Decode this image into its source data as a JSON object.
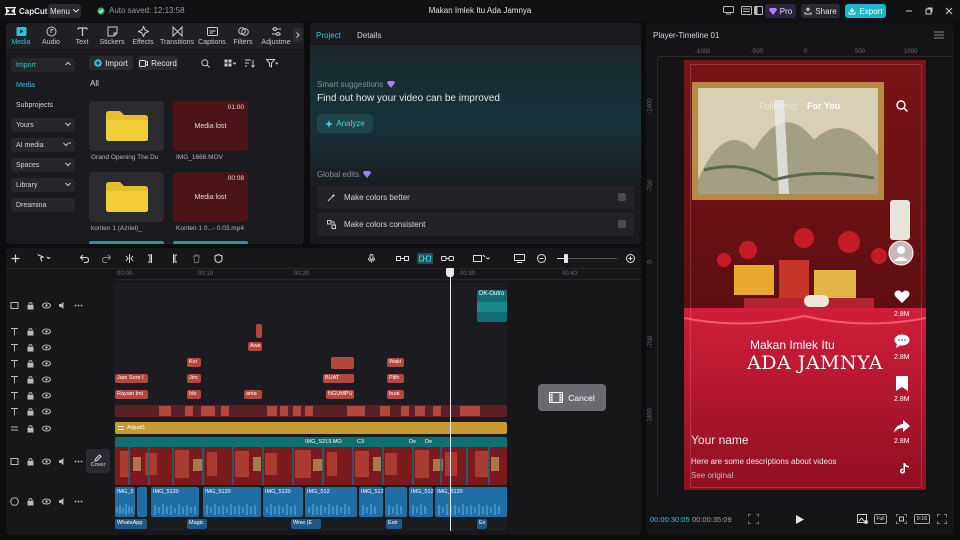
{
  "app": {
    "logo": "CapCut",
    "menu_label": "Menu",
    "autosave": "Auto saved: 12:13:58",
    "project_title": "Makan Imlek Itu Ada Jamnya"
  },
  "topbar": {
    "pro_label": "Pro",
    "share_label": "Share",
    "export_label": "Export"
  },
  "toolbar": {
    "tabs": [
      {
        "label": "Media"
      },
      {
        "label": "Audio"
      },
      {
        "label": "Text"
      },
      {
        "label": "Stickers"
      },
      {
        "label": "Effects"
      },
      {
        "label": "Transitions"
      },
      {
        "label": "Captions"
      },
      {
        "label": "Filters"
      },
      {
        "label": "Adjustme"
      }
    ]
  },
  "left_nav": {
    "items": [
      {
        "label": "Import"
      },
      {
        "label": "Media"
      },
      {
        "label": "Subprojects"
      },
      {
        "label": "Yours"
      },
      {
        "label": "AI media"
      },
      {
        "label": "Spaces"
      },
      {
        "label": "Library"
      },
      {
        "label": "Dreamina"
      }
    ]
  },
  "media": {
    "import_label": "Import",
    "record_label": "Record",
    "filter_all": "All",
    "cards": [
      {
        "label": "Grand Opening The Du",
        "type": "folder",
        "duration": ""
      },
      {
        "label": "IMG_1666.MOV",
        "type": "lost",
        "status": "Media lost",
        "duration": "01:00"
      },
      {
        "label": "konten 1 (Azriel)_",
        "type": "folder",
        "duration": ""
      },
      {
        "label": "Konten 1 0...- 0.03.mp4",
        "type": "lost",
        "status": "Media lost",
        "duration": "00:08"
      }
    ]
  },
  "project_panel": {
    "tabs": [
      {
        "label": "Project"
      },
      {
        "label": "Details"
      }
    ],
    "smart_title": "Smart suggestions",
    "smart_heading": "Find out how your video can be improved",
    "analyze_label": "Analyze",
    "global_title": "Global edits",
    "edits": [
      {
        "label": "Make colors better"
      },
      {
        "label": "Make colors consistent"
      }
    ]
  },
  "player": {
    "title": "Player-Timeline 01",
    "ruler_top": [
      "-1000",
      "-500",
      "0",
      "500",
      "1000"
    ],
    "ruler_left": [
      "-1400",
      "-700",
      "0",
      "-700",
      "-1400"
    ],
    "overlay_text_1": "Makan Imlek Itu",
    "overlay_text_2": "ADA JAMNYA",
    "tiktok_tabs": [
      "Following",
      "For You"
    ],
    "counts": [
      "2.8M",
      "2.8M",
      "2.8M",
      "2.8M"
    ],
    "your_name": "Your name",
    "description": "Here are some descriptions about videos",
    "see_original": "See original",
    "current_time": "00:00:30:05",
    "total_time": "00:00:35:09",
    "full_label": "Full",
    "ratio_label": "9:16"
  },
  "timeline": {
    "ruler": [
      "00:00",
      "00:10",
      "00:20",
      "00:30",
      "00:40"
    ],
    "cover_label": "Cover",
    "cancel_label": "Cancel",
    "outro_label": "DK-Outro",
    "adjust_label": "Adjust1",
    "text_clips": [
      "Kei",
      "Awa",
      "Waki",
      "Jam Sore I",
      "Jim",
      "BUAT",
      "Pilih",
      "Rayain Imi",
      "Ide",
      "anta",
      "NGUMPU",
      "buat"
    ],
    "video_clips": [
      "IMG_S219.MO",
      "De",
      "De",
      "C3"
    ],
    "audio_clips": [
      "IMG_5",
      "IMG_5120",
      "IMG_5120",
      "IMG_5120",
      "IMG_512",
      "IMG_512",
      "IMG_512",
      "IMG_5120"
    ],
    "sfx_clips": [
      "WhatsApp",
      "Magic",
      "Wow (E",
      "Extr",
      "Ex"
    ]
  },
  "colors": {
    "accent": "#2ec4d6",
    "export": "#19b8c9",
    "lost": "#4a1418",
    "text_clip": "#b3473d",
    "adjust": "#c89a33",
    "audio": "#1f6ea5"
  }
}
